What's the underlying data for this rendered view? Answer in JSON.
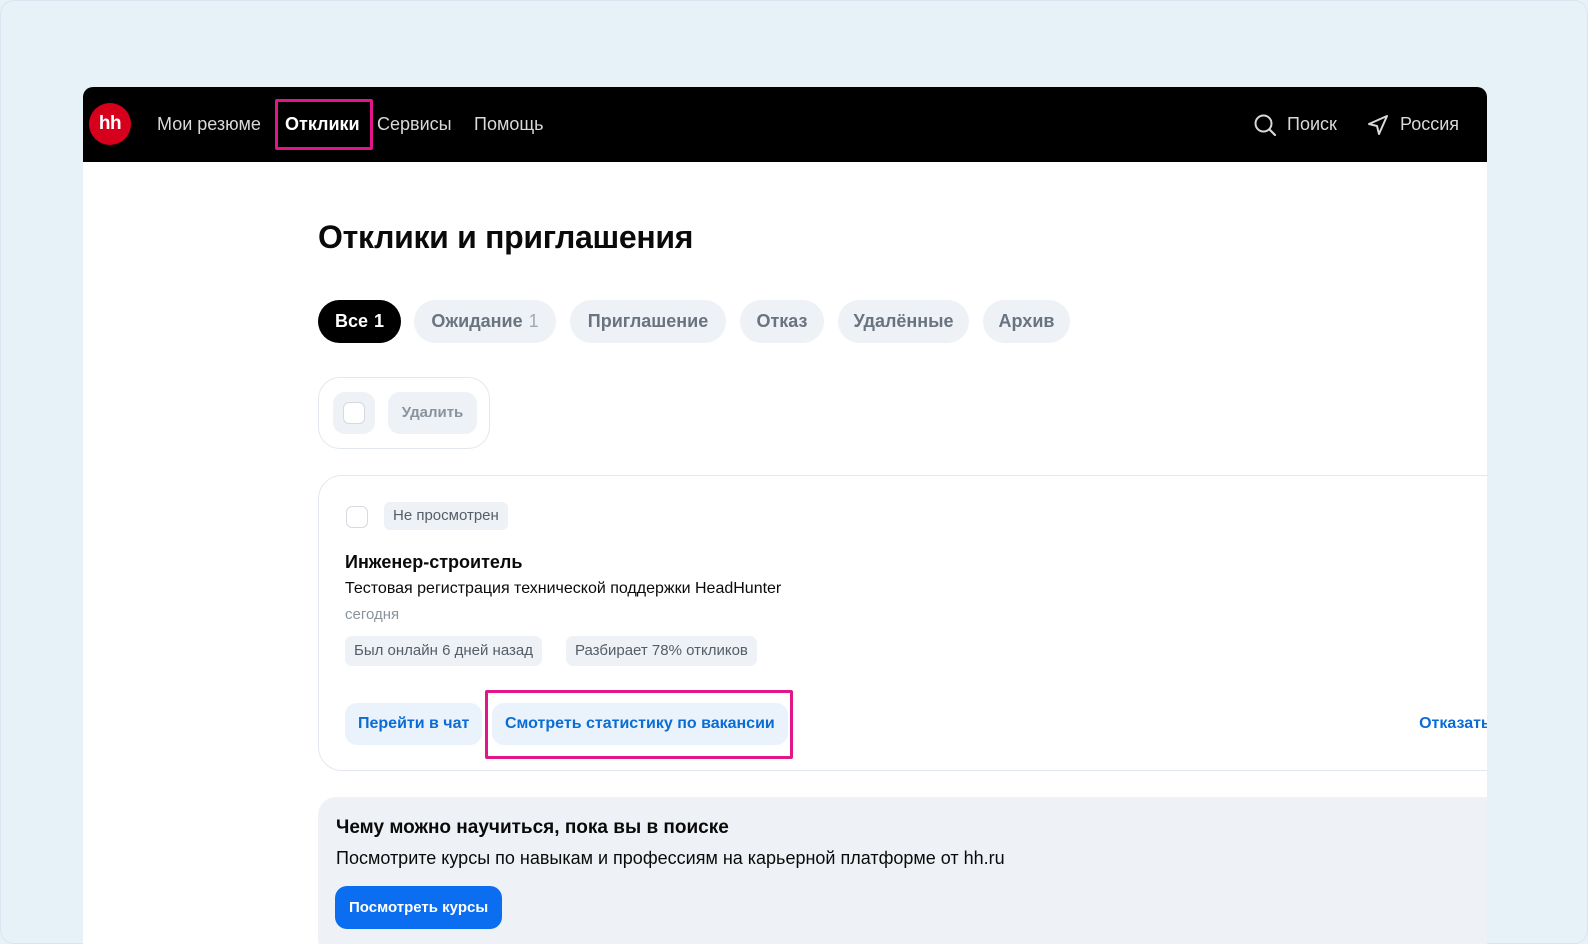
{
  "header": {
    "logo_text": "hh",
    "nav": {
      "resumes": "Мои резюме",
      "responses": "Отклики",
      "services": "Сервисы",
      "help": "Помощь"
    },
    "search_label": "Поиск",
    "region_label": "Россия"
  },
  "page": {
    "title": "Отклики и приглашения"
  },
  "tabs": [
    {
      "label": "Все",
      "count": "1",
      "active": true
    },
    {
      "label": "Ожидание",
      "count": "1"
    },
    {
      "label": "Приглашение"
    },
    {
      "label": "Отказ"
    },
    {
      "label": "Удалённые"
    },
    {
      "label": "Архив"
    }
  ],
  "bulk": {
    "delete_label": "Удалить"
  },
  "response_card": {
    "status": "Не просмотрен",
    "vacancy_title": "Инженер-строитель",
    "company": "Тестовая регистрация технической поддержки HeadHunter",
    "date": "сегодня",
    "chips": [
      "Был онлайн 6 дней назад",
      "Разбирает 78% откликов"
    ],
    "chat_button": "Перейти в чат",
    "stats_button": "Смотреть статистику по вакансии",
    "decline_link": "Отказаться"
  },
  "promo": {
    "title": "Чему можно научиться, пока вы в поиске",
    "text": "Посмотрите курсы по навыкам и профессиям на карьерной платформе от hh.ru",
    "button": "Посмотреть курсы"
  },
  "colors": {
    "highlight": "#e0168a",
    "brand_red": "#d6001c",
    "link_blue": "#0a6cd6",
    "primary_button": "#0b6ef0"
  }
}
